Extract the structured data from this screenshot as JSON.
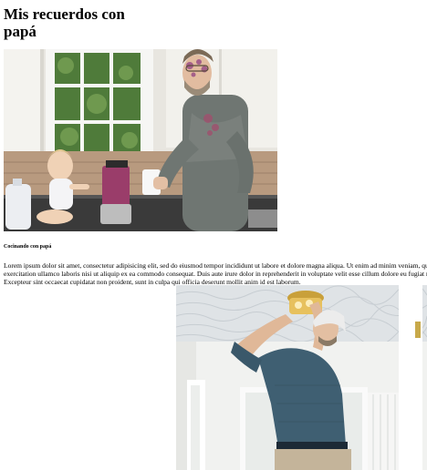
{
  "article": {
    "title": "Mis recuerdos con papá",
    "caption": "Cocinando con papá",
    "body": "Lorem ipsum dolor sit amet, consectetur adipisicing elit, sed do eiusmod tempor incididunt ut labore et dolore magna aliqua. Ut enim ad minim veniam, quis nostrud exercitation ullamco laboris nisi ut aliquip ex ea commodo consequat. Duis aute irure dolor in reprehenderit in voluptate velit esse cillum dolore eu fugiat nulla pariatur. Excepteur sint occaecat cupidatat non proident, sunt in culpa qui officia deserunt mollit anim id est laborum."
  },
  "colors": {
    "text": "#000000",
    "background": "#ffffff"
  }
}
